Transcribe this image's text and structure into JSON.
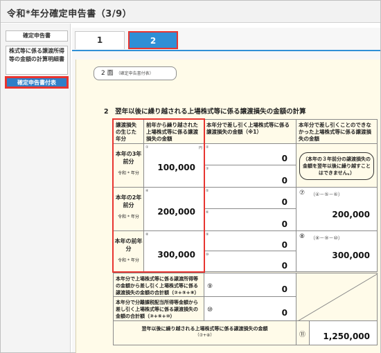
{
  "window": {
    "title": "令和*年分確定申告書（3/9）"
  },
  "sidebar": {
    "items": [
      {
        "label": "確定申告書"
      },
      {
        "label": "株式等に係る譲渡所得等の金額の計算明細書"
      },
      {
        "label": "確定申告書付表"
      }
    ]
  },
  "tabs": [
    {
      "label": "1"
    },
    {
      "label": "2"
    }
  ],
  "page": {
    "men_label": "2 面",
    "men_sub": "（確定申告書付表）",
    "section_title": "2　翌年以後に繰り越される上場株式等に係る譲渡損失の金額の計算"
  },
  "table": {
    "headers": {
      "col1": "譲渡損失の生じた年分",
      "col2": "前年から繰り越された上場株式等に係る譲渡損失の金額",
      "col3": "本年分で差し引く上場株式等に係る譲渡損失の金額（※1）",
      "col4": "本年分で差し引くことのできなかった上場株式等に係る譲渡損失の金額"
    },
    "rows": [
      {
        "label": "本年の3年前分",
        "era": "令和 * 年分",
        "carry_label": "①",
        "carry_value": "100,000",
        "sub1_label": "②",
        "sub1_value": "0",
        "sub2_label": "③",
        "sub2_value": "0"
      },
      {
        "label": "本年の2年前分",
        "era": "令和 * 年分",
        "carry_label": "④",
        "carry_value": "200,000",
        "sub1_label": "⑤",
        "sub1_value": "0",
        "sub2_label": "⑥",
        "sub2_value": "0",
        "remain_label": "⑦",
        "remain_formula": "（④－⑤－⑥）",
        "remain_value": "200,000"
      },
      {
        "label": "本年の前年分",
        "era": "令和 * 年分",
        "carry_label": "⑧",
        "carry_value": "300,000",
        "sub1_label": "⑨",
        "sub1_value": "0",
        "sub2_label": "⑩",
        "sub2_value": "0",
        "remain_label": "⑧",
        "remain_formula": "（⑧－⑨－⑩）",
        "remain_value": "300,000"
      }
    ],
    "note": "（本年の３年前分の譲渡損失の金額を翌年以後に繰り越すことはできません。）",
    "total_row1_label": "本年分で上場株式等に係る譲渡所得等の金額から差し引く上場株式等に係る譲渡損失の金額の合計額（②+⑤+⑧）",
    "total_row1_marker": "⑨",
    "total_row1_value": "0",
    "total_row2_label": "本年分で分離課税配当所得等金額から差し引く上場株式等に係る譲渡損失の金額の合計額（③+⑥+⑩）",
    "total_row2_marker": "⑩",
    "total_row2_value": "0",
    "final_label": "翌年以後に繰り越される上場株式等に係る譲渡損失の金額",
    "final_formula": "（⑦+⑧）",
    "final_marker": "⑪",
    "final_value": "1,250,000",
    "unit": "円"
  },
  "colors": {
    "accent": "#2f8fd6",
    "highlight": "#e8342f",
    "paper": "#fffbe9"
  }
}
